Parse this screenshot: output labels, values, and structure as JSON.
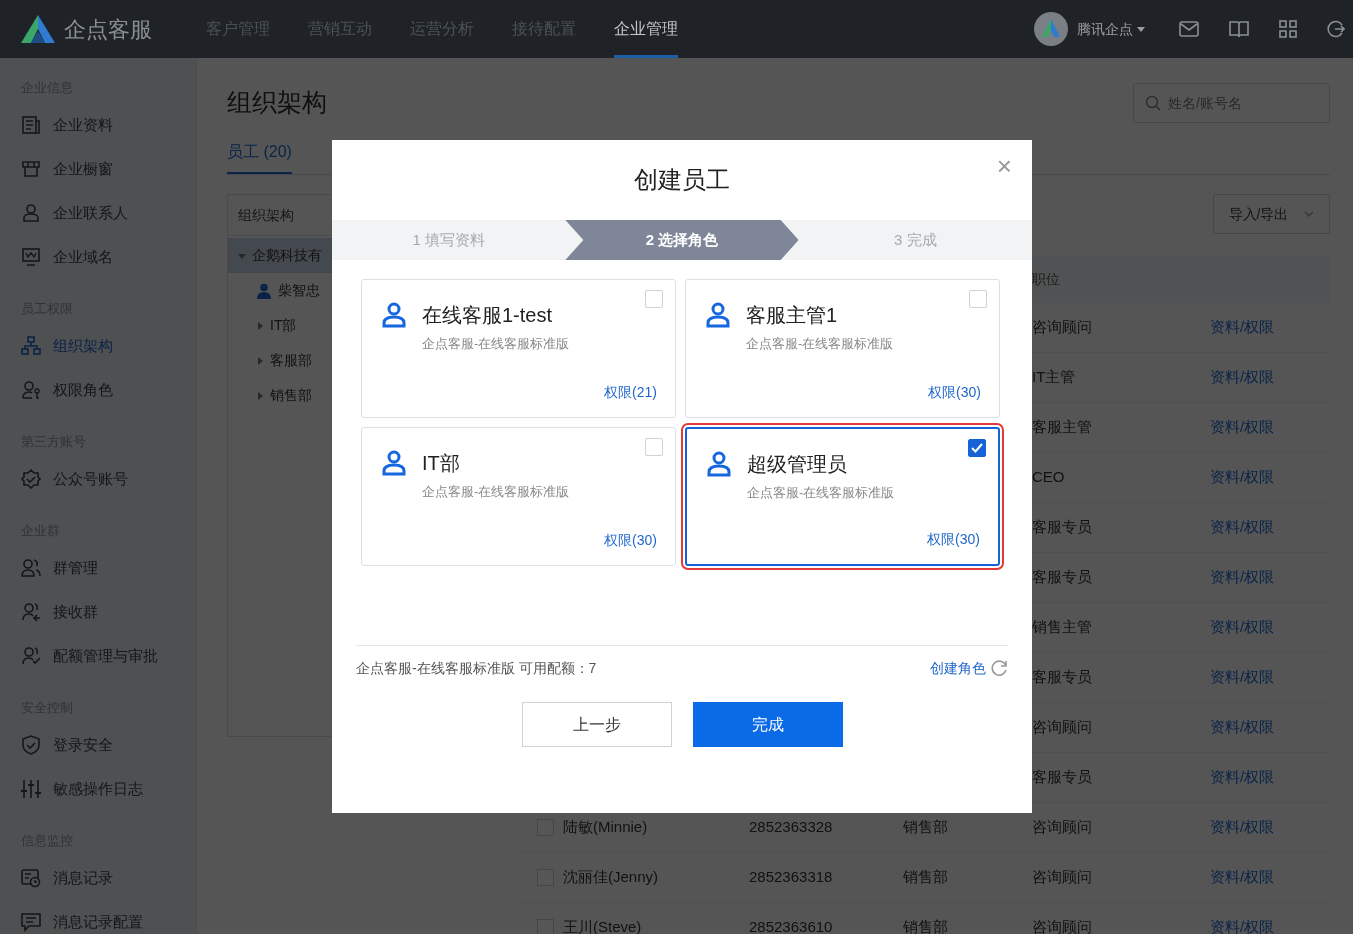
{
  "topbar": {
    "brand": "企点客服",
    "menu": [
      {
        "label": "客户管理",
        "selected": false
      },
      {
        "label": "营销互动",
        "selected": false
      },
      {
        "label": "运营分析",
        "selected": false
      },
      {
        "label": "接待配置",
        "selected": false
      },
      {
        "label": "企业管理",
        "selected": true
      }
    ],
    "account": "腾讯企点"
  },
  "sidebar": {
    "groups": [
      {
        "heading": "企业信息",
        "items": [
          {
            "label": "企业资料",
            "kind": "doc",
            "selected": false
          },
          {
            "label": "企业橱窗",
            "kind": "store",
            "selected": false
          },
          {
            "label": "企业联系人",
            "kind": "person",
            "selected": false
          },
          {
            "label": "企业域名",
            "kind": "monitor",
            "selected": false
          }
        ]
      },
      {
        "heading": "员工权限",
        "items": [
          {
            "label": "组织架构",
            "kind": "tree",
            "selected": true
          },
          {
            "label": "权限角色",
            "kind": "personkey",
            "selected": false
          }
        ]
      },
      {
        "heading": "第三方账号",
        "items": [
          {
            "label": "公众号账号",
            "kind": "badge",
            "selected": false
          }
        ]
      },
      {
        "heading": "企业群",
        "items": [
          {
            "label": "群管理",
            "kind": "people",
            "selected": false
          },
          {
            "label": "接收群",
            "kind": "peoplein",
            "selected": false
          },
          {
            "label": "配额管理与审批",
            "kind": "peoplecheck",
            "selected": false
          }
        ]
      },
      {
        "heading": "安全控制",
        "items": [
          {
            "label": "登录安全",
            "kind": "shield",
            "selected": false
          },
          {
            "label": "敏感操作日志",
            "kind": "sliders",
            "selected": false
          }
        ]
      },
      {
        "heading": "信息监控",
        "items": [
          {
            "label": "消息记录",
            "kind": "history",
            "selected": false
          },
          {
            "label": "消息记录配置",
            "kind": "message",
            "selected": false
          }
        ]
      }
    ]
  },
  "page": {
    "title": "组织架构",
    "search": {
      "placeholder": "姓名/账号名"
    },
    "tabs": [
      {
        "label": "员工 (20)",
        "selected": true
      }
    ]
  },
  "tree": {
    "title": "组织架构",
    "nodes": [
      {
        "label": "企鹅科技有",
        "kind": "dept",
        "expanded": true,
        "selected": true,
        "children": [
          {
            "label": "柴智忠",
            "kind": "person"
          },
          {
            "label": "IT部",
            "kind": "dept",
            "expanded": false,
            "selected": false
          },
          {
            "label": "客服部",
            "kind": "dept",
            "expanded": false,
            "selected": false
          },
          {
            "label": "销售部",
            "kind": "dept",
            "expanded": false,
            "selected": false
          }
        ]
      }
    ]
  },
  "table": {
    "import_button": "导入/导出",
    "position_header": "职位",
    "rows": [
      {
        "position": "咨询顾问",
        "action": "资料/权限"
      },
      {
        "position": "IT主管",
        "action": "资料/权限"
      },
      {
        "position": "客服主管",
        "action": "资料/权限"
      },
      {
        "position": "CEO",
        "action": "资料/权限"
      },
      {
        "position": "客服专员",
        "action": "资料/权限"
      },
      {
        "position": "客服专员",
        "action": "资料/权限"
      },
      {
        "position": "销售主管",
        "action": "资料/权限"
      },
      {
        "position": "客服专员",
        "action": "资料/权限"
      },
      {
        "position": "咨询顾问",
        "action": "资料/权限"
      },
      {
        "position": "客服专员",
        "action": "资料/权限"
      },
      {
        "checked": false,
        "name": "陆敏(Minnie)",
        "account": "2852363328",
        "department": "销售部",
        "position": "咨询顾问",
        "action": "资料/权限"
      },
      {
        "checked": false,
        "name": "沈丽佳(Jenny)",
        "account": "2852363318",
        "department": "销售部",
        "position": "咨询顾问",
        "action": "资料/权限"
      },
      {
        "checked": false,
        "name": "王川(Steve)",
        "account": "2852363610",
        "department": "销售部",
        "position": "咨询顾问",
        "action": "资料/权限"
      }
    ]
  },
  "dialog": {
    "title": "创建员工",
    "close": "×",
    "steps": [
      {
        "label": "1 填写资料",
        "selected": false
      },
      {
        "label": "2 选择角色",
        "selected": true
      },
      {
        "label": "3 完成",
        "selected": false
      }
    ],
    "roles": [
      {
        "name": "在线客服1-test",
        "product": "企点客服-在线客服标准版",
        "permissions": "权限(21)",
        "checked": false
      },
      {
        "name": "客服主管1",
        "product": "企点客服-在线客服标准版",
        "permissions": "权限(30)",
        "checked": false
      },
      {
        "name": "IT部",
        "product": "企点客服-在线客服标准版",
        "permissions": "权限(30)",
        "checked": false
      },
      {
        "name": "超级管理员",
        "product": "企点客服-在线客服标准版",
        "permissions": "权限(30)",
        "checked": true
      }
    ],
    "quota": "企点客服-在线客服标准版 可用配额：7",
    "create_role": "创建角色",
    "buttons": [
      {
        "label": "上一步",
        "kind": "secondary"
      },
      {
        "label": "完成",
        "kind": "primary"
      }
    ]
  }
}
